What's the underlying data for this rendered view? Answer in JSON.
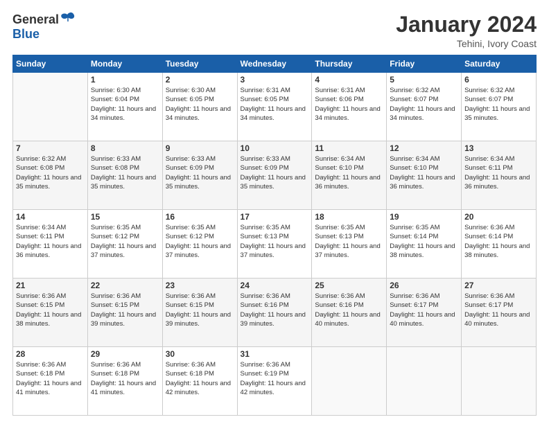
{
  "logo": {
    "general": "General",
    "blue": "Blue"
  },
  "title": "January 2024",
  "subtitle": "Tehini, Ivory Coast",
  "days_header": [
    "Sunday",
    "Monday",
    "Tuesday",
    "Wednesday",
    "Thursday",
    "Friday",
    "Saturday"
  ],
  "weeks": [
    [
      {
        "day": "",
        "sunrise": "",
        "sunset": "",
        "daylight": ""
      },
      {
        "day": "1",
        "sunrise": "Sunrise: 6:30 AM",
        "sunset": "Sunset: 6:04 PM",
        "daylight": "Daylight: 11 hours and 34 minutes."
      },
      {
        "day": "2",
        "sunrise": "Sunrise: 6:30 AM",
        "sunset": "Sunset: 6:05 PM",
        "daylight": "Daylight: 11 hours and 34 minutes."
      },
      {
        "day": "3",
        "sunrise": "Sunrise: 6:31 AM",
        "sunset": "Sunset: 6:05 PM",
        "daylight": "Daylight: 11 hours and 34 minutes."
      },
      {
        "day": "4",
        "sunrise": "Sunrise: 6:31 AM",
        "sunset": "Sunset: 6:06 PM",
        "daylight": "Daylight: 11 hours and 34 minutes."
      },
      {
        "day": "5",
        "sunrise": "Sunrise: 6:32 AM",
        "sunset": "Sunset: 6:07 PM",
        "daylight": "Daylight: 11 hours and 34 minutes."
      },
      {
        "day": "6",
        "sunrise": "Sunrise: 6:32 AM",
        "sunset": "Sunset: 6:07 PM",
        "daylight": "Daylight: 11 hours and 35 minutes."
      }
    ],
    [
      {
        "day": "7",
        "sunrise": "Sunrise: 6:32 AM",
        "sunset": "Sunset: 6:08 PM",
        "daylight": "Daylight: 11 hours and 35 minutes."
      },
      {
        "day": "8",
        "sunrise": "Sunrise: 6:33 AM",
        "sunset": "Sunset: 6:08 PM",
        "daylight": "Daylight: 11 hours and 35 minutes."
      },
      {
        "day": "9",
        "sunrise": "Sunrise: 6:33 AM",
        "sunset": "Sunset: 6:09 PM",
        "daylight": "Daylight: 11 hours and 35 minutes."
      },
      {
        "day": "10",
        "sunrise": "Sunrise: 6:33 AM",
        "sunset": "Sunset: 6:09 PM",
        "daylight": "Daylight: 11 hours and 35 minutes."
      },
      {
        "day": "11",
        "sunrise": "Sunrise: 6:34 AM",
        "sunset": "Sunset: 6:10 PM",
        "daylight": "Daylight: 11 hours and 36 minutes."
      },
      {
        "day": "12",
        "sunrise": "Sunrise: 6:34 AM",
        "sunset": "Sunset: 6:10 PM",
        "daylight": "Daylight: 11 hours and 36 minutes."
      },
      {
        "day": "13",
        "sunrise": "Sunrise: 6:34 AM",
        "sunset": "Sunset: 6:11 PM",
        "daylight": "Daylight: 11 hours and 36 minutes."
      }
    ],
    [
      {
        "day": "14",
        "sunrise": "Sunrise: 6:34 AM",
        "sunset": "Sunset: 6:11 PM",
        "daylight": "Daylight: 11 hours and 36 minutes."
      },
      {
        "day": "15",
        "sunrise": "Sunrise: 6:35 AM",
        "sunset": "Sunset: 6:12 PM",
        "daylight": "Daylight: 11 hours and 37 minutes."
      },
      {
        "day": "16",
        "sunrise": "Sunrise: 6:35 AM",
        "sunset": "Sunset: 6:12 PM",
        "daylight": "Daylight: 11 hours and 37 minutes."
      },
      {
        "day": "17",
        "sunrise": "Sunrise: 6:35 AM",
        "sunset": "Sunset: 6:13 PM",
        "daylight": "Daylight: 11 hours and 37 minutes."
      },
      {
        "day": "18",
        "sunrise": "Sunrise: 6:35 AM",
        "sunset": "Sunset: 6:13 PM",
        "daylight": "Daylight: 11 hours and 37 minutes."
      },
      {
        "day": "19",
        "sunrise": "Sunrise: 6:35 AM",
        "sunset": "Sunset: 6:14 PM",
        "daylight": "Daylight: 11 hours and 38 minutes."
      },
      {
        "day": "20",
        "sunrise": "Sunrise: 6:36 AM",
        "sunset": "Sunset: 6:14 PM",
        "daylight": "Daylight: 11 hours and 38 minutes."
      }
    ],
    [
      {
        "day": "21",
        "sunrise": "Sunrise: 6:36 AM",
        "sunset": "Sunset: 6:15 PM",
        "daylight": "Daylight: 11 hours and 38 minutes."
      },
      {
        "day": "22",
        "sunrise": "Sunrise: 6:36 AM",
        "sunset": "Sunset: 6:15 PM",
        "daylight": "Daylight: 11 hours and 39 minutes."
      },
      {
        "day": "23",
        "sunrise": "Sunrise: 6:36 AM",
        "sunset": "Sunset: 6:15 PM",
        "daylight": "Daylight: 11 hours and 39 minutes."
      },
      {
        "day": "24",
        "sunrise": "Sunrise: 6:36 AM",
        "sunset": "Sunset: 6:16 PM",
        "daylight": "Daylight: 11 hours and 39 minutes."
      },
      {
        "day": "25",
        "sunrise": "Sunrise: 6:36 AM",
        "sunset": "Sunset: 6:16 PM",
        "daylight": "Daylight: 11 hours and 40 minutes."
      },
      {
        "day": "26",
        "sunrise": "Sunrise: 6:36 AM",
        "sunset": "Sunset: 6:17 PM",
        "daylight": "Daylight: 11 hours and 40 minutes."
      },
      {
        "day": "27",
        "sunrise": "Sunrise: 6:36 AM",
        "sunset": "Sunset: 6:17 PM",
        "daylight": "Daylight: 11 hours and 40 minutes."
      }
    ],
    [
      {
        "day": "28",
        "sunrise": "Sunrise: 6:36 AM",
        "sunset": "Sunset: 6:18 PM",
        "daylight": "Daylight: 11 hours and 41 minutes."
      },
      {
        "day": "29",
        "sunrise": "Sunrise: 6:36 AM",
        "sunset": "Sunset: 6:18 PM",
        "daylight": "Daylight: 11 hours and 41 minutes."
      },
      {
        "day": "30",
        "sunrise": "Sunrise: 6:36 AM",
        "sunset": "Sunset: 6:18 PM",
        "daylight": "Daylight: 11 hours and 42 minutes."
      },
      {
        "day": "31",
        "sunrise": "Sunrise: 6:36 AM",
        "sunset": "Sunset: 6:19 PM",
        "daylight": "Daylight: 11 hours and 42 minutes."
      },
      {
        "day": "",
        "sunrise": "",
        "sunset": "",
        "daylight": ""
      },
      {
        "day": "",
        "sunrise": "",
        "sunset": "",
        "daylight": ""
      },
      {
        "day": "",
        "sunrise": "",
        "sunset": "",
        "daylight": ""
      }
    ]
  ]
}
